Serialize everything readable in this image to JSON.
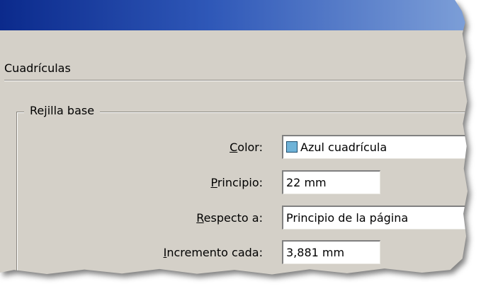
{
  "panel": {
    "section_title": "Cuadrículas",
    "group_title": "Rejilla base"
  },
  "rows": {
    "color": {
      "label_prefix": "",
      "label_mnemonic": "C",
      "label_rest": "olor:",
      "value": "Azul cuadrícula",
      "swatch_color": "#6fb3d8"
    },
    "start": {
      "label_mnemonic": "P",
      "label_rest": "rincipio:",
      "value": "22 mm"
    },
    "relative_to": {
      "label_mnemonic": "R",
      "label_rest": "especto a:",
      "value": "Principio de la página"
    },
    "increment": {
      "label_mnemonic": "I",
      "label_rest": "ncremento cada:",
      "value": "3,881 mm"
    }
  },
  "colors": {
    "dialog_bg": "#d4d0c8",
    "titlebar_start": "#0b2a8c",
    "titlebar_end": "#7d9fd8"
  }
}
